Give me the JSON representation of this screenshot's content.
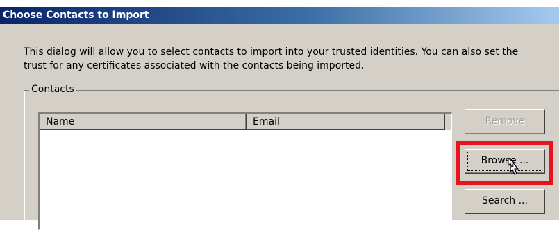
{
  "window": {
    "title": "Choose Contacts to Import"
  },
  "description": "This dialog will allow you to select contacts to import into your trusted identities. You can also set the\ntrust for any certificates associated with the contacts being imported.",
  "contacts_group": {
    "label": "Contacts",
    "columns": [
      "Name",
      "Email"
    ],
    "rows": []
  },
  "buttons": {
    "remove": {
      "label": "Remove",
      "enabled": false
    },
    "browse": {
      "label": "Browse ...",
      "enabled": true
    },
    "search": {
      "label": "Search ...",
      "enabled": true
    }
  },
  "annotation": {
    "highlight_color": "#e8131f",
    "highlighted_control": "browse"
  },
  "colors": {
    "title_gradient_start": "#0a246a",
    "title_gradient_end": "#a6caf0",
    "face": "#d4d0c8"
  }
}
